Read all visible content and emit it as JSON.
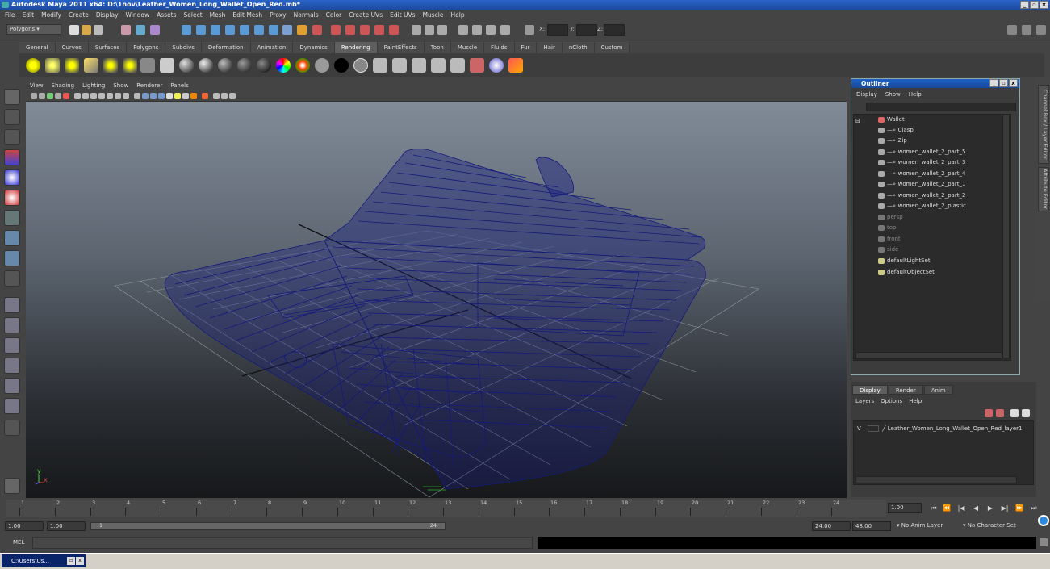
{
  "window": {
    "title": "Autodesk Maya 2011 x64: D:\\1nov\\Leather_Women_Long_Wallet_Open_Red.mb*",
    "controls": [
      "_",
      "▫",
      "x"
    ]
  },
  "menubar": [
    "File",
    "Edit",
    "Modify",
    "Create",
    "Display",
    "Window",
    "Assets",
    "Select",
    "Mesh",
    "Edit Mesh",
    "Proxy",
    "Normals",
    "Color",
    "Create UVs",
    "Edit UVs",
    "Muscle",
    "Help"
  ],
  "status": {
    "mode": "Polygons",
    "x_label": "X:",
    "y_label": "Y:",
    "z_label": "Z:"
  },
  "shelf_tabs": [
    "General",
    "Curves",
    "Surfaces",
    "Polygons",
    "Subdivs",
    "Deformation",
    "Animation",
    "Dynamics",
    "Rendering",
    "PaintEffects",
    "Toon",
    "Muscle",
    "Fluids",
    "Fur",
    "Hair",
    "nCloth",
    "Custom"
  ],
  "active_shelf": "Rendering",
  "viewport_menu": [
    "View",
    "Shading",
    "Lighting",
    "Show",
    "Renderer",
    "Panels"
  ],
  "axis": {
    "x": "x",
    "y": "y"
  },
  "outliner": {
    "title": "Outliner",
    "menu": [
      "Display",
      "Show",
      "Help"
    ],
    "items": [
      {
        "label": "Wallet",
        "indent": 0,
        "dim": false
      },
      {
        "label": "Clasp",
        "indent": 1,
        "dim": false
      },
      {
        "label": "Zip",
        "indent": 1,
        "dim": false
      },
      {
        "label": "women_wallet_2_part_5",
        "indent": 1,
        "dim": false
      },
      {
        "label": "women_wallet_2_part_3",
        "indent": 1,
        "dim": false
      },
      {
        "label": "women_wallet_2_part_4",
        "indent": 1,
        "dim": false
      },
      {
        "label": "women_wallet_2_part_1",
        "indent": 1,
        "dim": false
      },
      {
        "label": "women_wallet_2_part_2",
        "indent": 1,
        "dim": false
      },
      {
        "label": "women_wallet_2_plastic",
        "indent": 1,
        "dim": false
      },
      {
        "label": "persp",
        "indent": 0,
        "dim": true
      },
      {
        "label": "top",
        "indent": 0,
        "dim": true
      },
      {
        "label": "front",
        "indent": 0,
        "dim": true
      },
      {
        "label": "side",
        "indent": 0,
        "dim": true
      },
      {
        "label": "defaultLightSet",
        "indent": 0,
        "dim": false
      },
      {
        "label": "defaultObjectSet",
        "indent": 0,
        "dim": false
      }
    ]
  },
  "side_tabs": [
    "Channel Box / Layer Editor",
    "Attribute Editor"
  ],
  "layer_editor": {
    "tabs": [
      "Display",
      "Render",
      "Anim"
    ],
    "menu": [
      "Layers",
      "Options",
      "Help"
    ],
    "layer": {
      "visibility": "V",
      "name": "Leather_Women_Long_Wallet_Open_Red_layer1"
    }
  },
  "timeline": {
    "ticks": [
      "1",
      "2",
      "3",
      "4",
      "5",
      "6",
      "7",
      "8",
      "9",
      "10",
      "11",
      "12",
      "13",
      "14",
      "15",
      "16",
      "17",
      "18",
      "19",
      "20",
      "21",
      "22",
      "23",
      "24"
    ],
    "current_frame": "1.00"
  },
  "range": {
    "start": "1.00",
    "anim_start": "1.00",
    "slider_start": "1",
    "slider_end": "24",
    "end": "24.00",
    "anim_end": "48.00",
    "anim_layer": "No Anim Layer",
    "char_set": "No Character Set"
  },
  "mel": {
    "label": "MEL"
  },
  "taskbar": {
    "item": "C:\\Users\\Us..."
  }
}
